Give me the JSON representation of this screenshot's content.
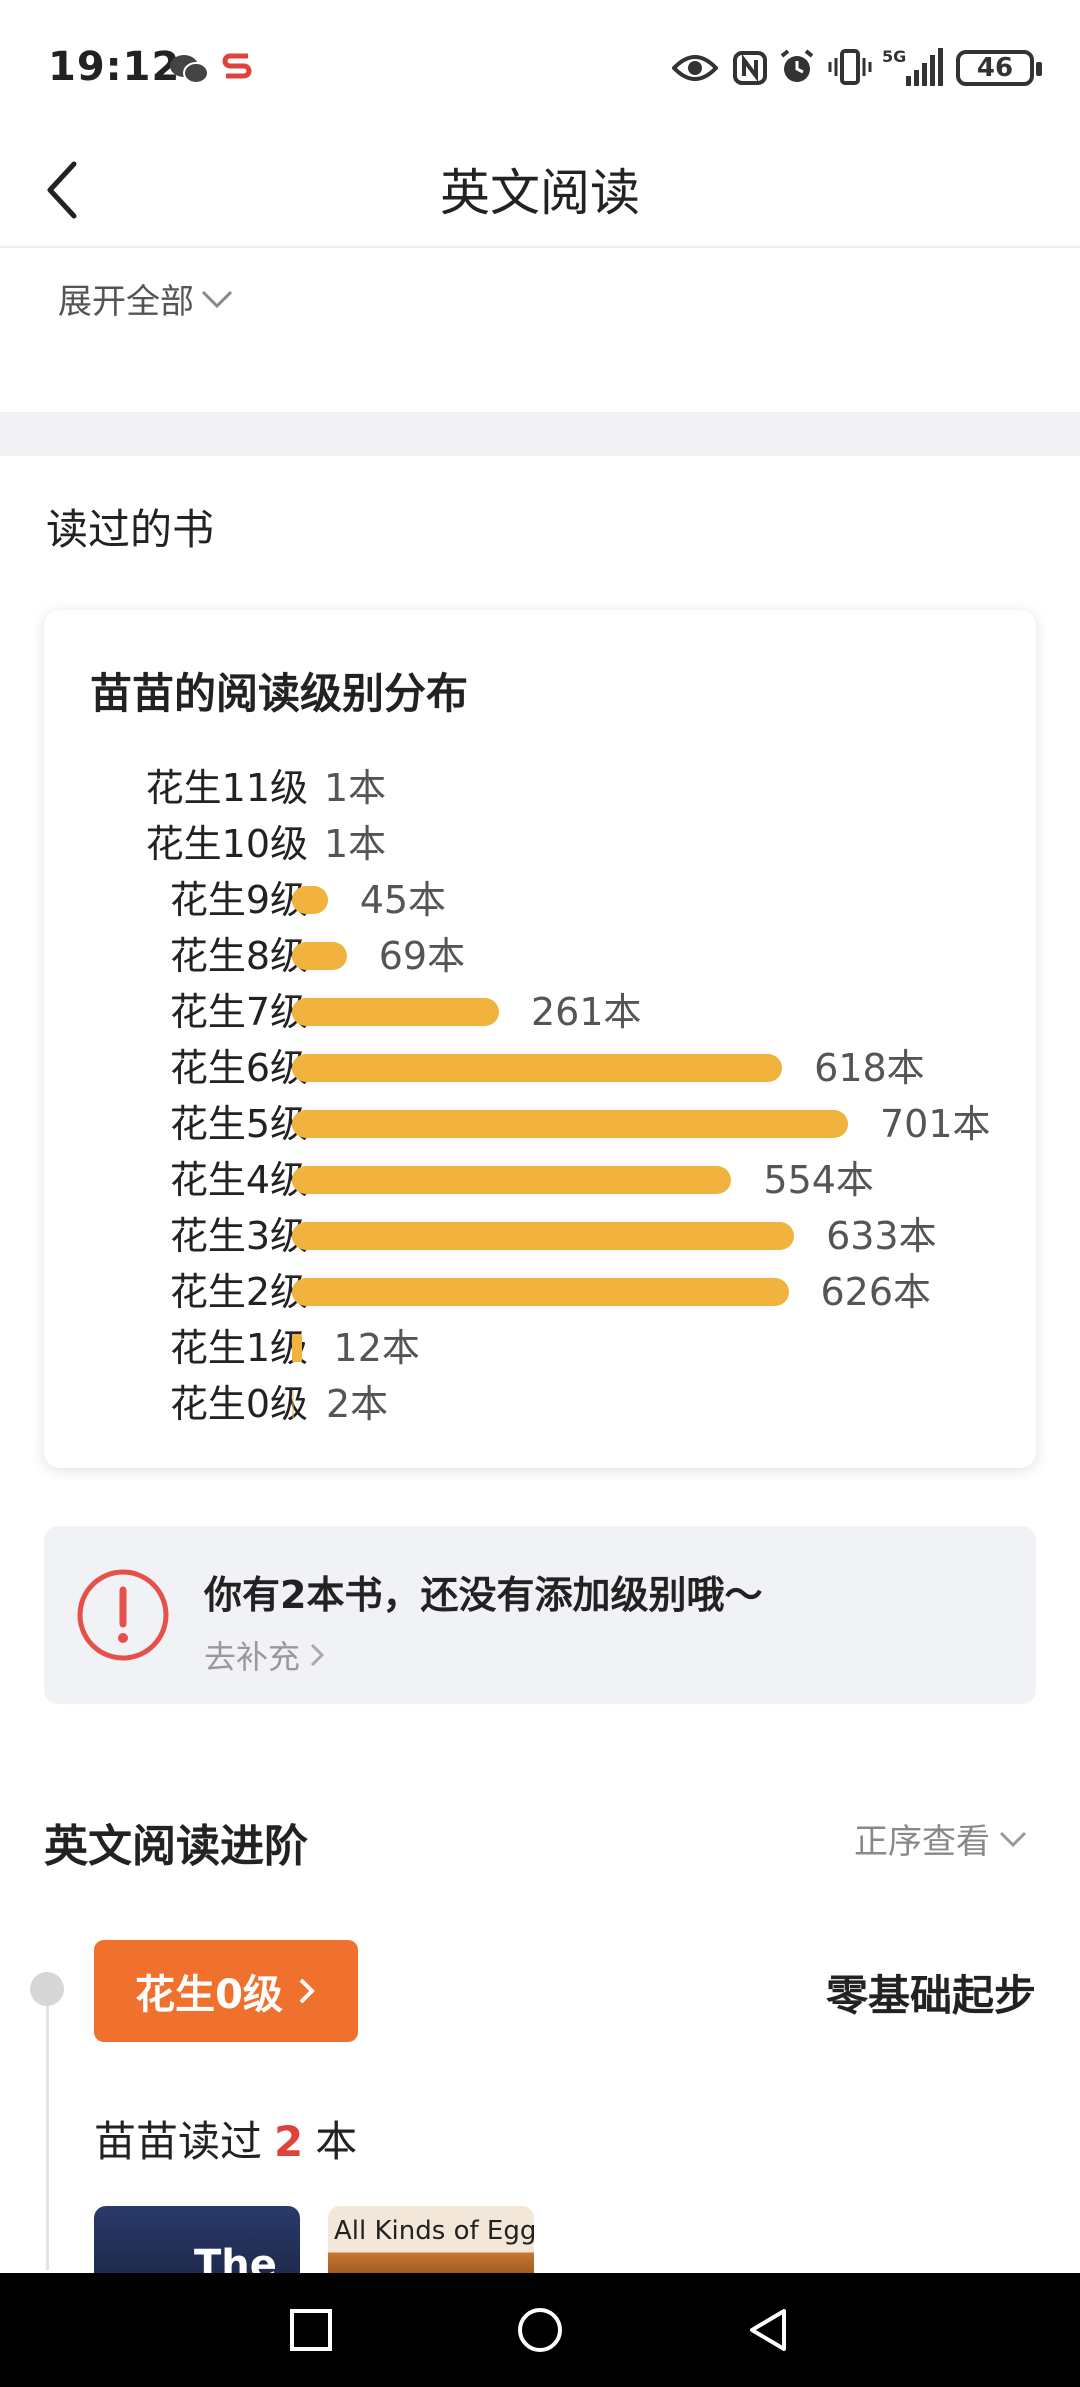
{
  "status_bar": {
    "time": "19:12",
    "battery": "46"
  },
  "header": {
    "title": "英文阅读"
  },
  "expand": {
    "label": "展开全部"
  },
  "read_books": {
    "heading": "读过的书"
  },
  "distribution_card": {
    "title": "苗苗的阅读级别分布",
    "rows": [
      {
        "label": "花生11级",
        "count_text": "1本",
        "value": 1
      },
      {
        "label": "花生10级",
        "count_text": "1本",
        "value": 1
      },
      {
        "label": "花生9级",
        "count_text": "45本",
        "value": 45
      },
      {
        "label": "花生8级",
        "count_text": "69本",
        "value": 69
      },
      {
        "label": "花生7级",
        "count_text": "261本",
        "value": 261
      },
      {
        "label": "花生6级",
        "count_text": "618本",
        "value": 618
      },
      {
        "label": "花生5级",
        "count_text": "701本",
        "value": 701
      },
      {
        "label": "花生4级",
        "count_text": "554本",
        "value": 554
      },
      {
        "label": "花生3级",
        "count_text": "633本",
        "value": 633
      },
      {
        "label": "花生2级",
        "count_text": "626本",
        "value": 626
      },
      {
        "label": "花生1级",
        "count_text": "12本",
        "value": 12
      },
      {
        "label": "花生0级",
        "count_text": "2本",
        "value": 2
      }
    ],
    "bar_color": "#f1b33d"
  },
  "notice": {
    "title": "你有2本书，还没有添加级别哦～",
    "link": "去补充"
  },
  "advance": {
    "heading": "英文阅读进阶",
    "sort_label": "正序查看",
    "level_button": "花生0级",
    "level_desc": "零基础起步",
    "read_prefix": "苗苗读过",
    "read_number": "2",
    "read_suffix": "本",
    "books": [
      {
        "cover_text": "The"
      },
      {
        "cover_text": "All Kinds of Eggs"
      }
    ],
    "accent_color": "#f0702d"
  }
}
